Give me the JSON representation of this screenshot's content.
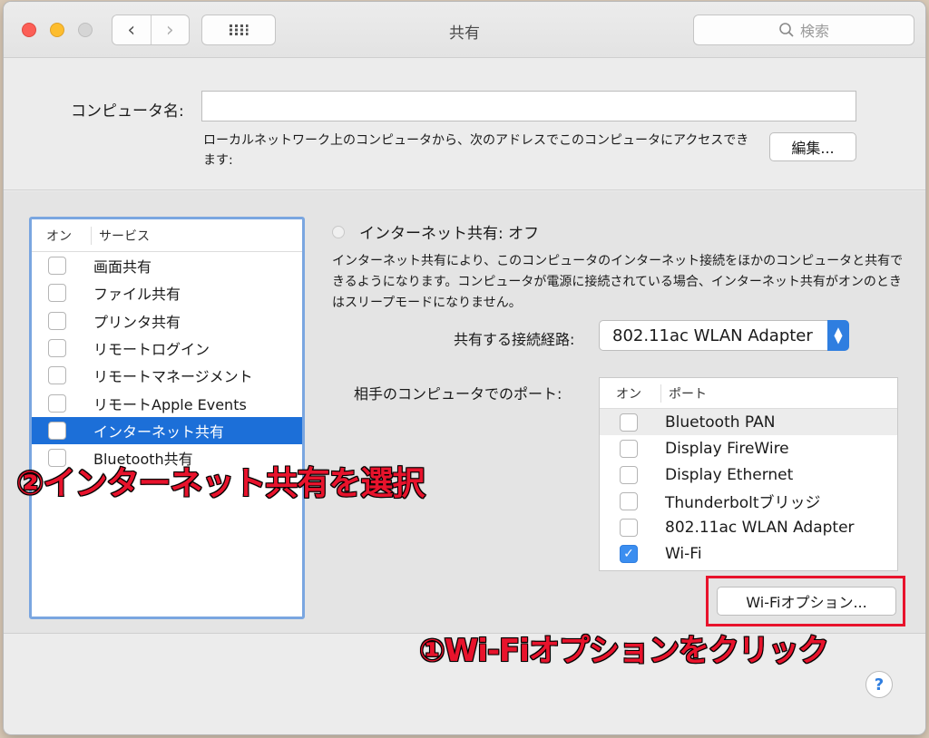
{
  "window": {
    "title": "共有",
    "nav_back_icon": "chevron-left-icon",
    "nav_forward_icon": "chevron-right-icon",
    "grid_icon": "show-all-grid-icon",
    "search_placeholder": "検索"
  },
  "computer_name": {
    "label": "コンピュータ名:",
    "value": "",
    "description": "ローカルネットワーク上のコンピュータから、次のアドレスでこのコンピュータにアクセスできます:",
    "edit_button": "編集..."
  },
  "services": {
    "header_on": "オン",
    "header_service": "サービス",
    "items": [
      {
        "label": "画面共有",
        "checked": false,
        "selected": false
      },
      {
        "label": "ファイル共有",
        "checked": false,
        "selected": false
      },
      {
        "label": "プリンタ共有",
        "checked": false,
        "selected": false
      },
      {
        "label": "リモートログイン",
        "checked": false,
        "selected": false
      },
      {
        "label": "リモートマネージメント",
        "checked": false,
        "selected": false
      },
      {
        "label": "リモートApple Events",
        "checked": false,
        "selected": false
      },
      {
        "label": "インターネット共有",
        "checked": false,
        "selected": true
      },
      {
        "label": "Bluetooth共有",
        "checked": false,
        "selected": false
      }
    ]
  },
  "internet_sharing": {
    "status": "インターネット共有: オフ",
    "description": "インターネット共有により、このコンピュータのインターネット接続をほかのコンピュータと共有できるようになります。コンピュータが電源に接続されている場合、インターネット共有がオンのときはスリープモードになりません。",
    "share_from_label": "共有する接続経路:",
    "share_from_value": "802.11ac WLAN Adapter",
    "ports_label": "相手のコンピュータでのポート:",
    "ports_header_on": "オン",
    "ports_header_port": "ポート",
    "ports": [
      {
        "label": "Bluetooth PAN",
        "checked": false
      },
      {
        "label": "Display FireWire",
        "checked": false
      },
      {
        "label": "Display Ethernet",
        "checked": false
      },
      {
        "label": "Thunderboltブリッジ",
        "checked": false
      },
      {
        "label": "802.11ac WLAN Adapter",
        "checked": false
      },
      {
        "label": "Wi-Fi",
        "checked": true
      }
    ],
    "wifi_options_button": "Wi-Fiオプション..."
  },
  "help_button": "?",
  "annotations": {
    "step2": "②インターネット共有を選択",
    "step1": "①Wi-Fiオプションをクリック"
  },
  "colors": {
    "selection": "#1c6fd8",
    "highlight_box": "#e8132c",
    "checkbox_checked": "#3b8ef0"
  }
}
